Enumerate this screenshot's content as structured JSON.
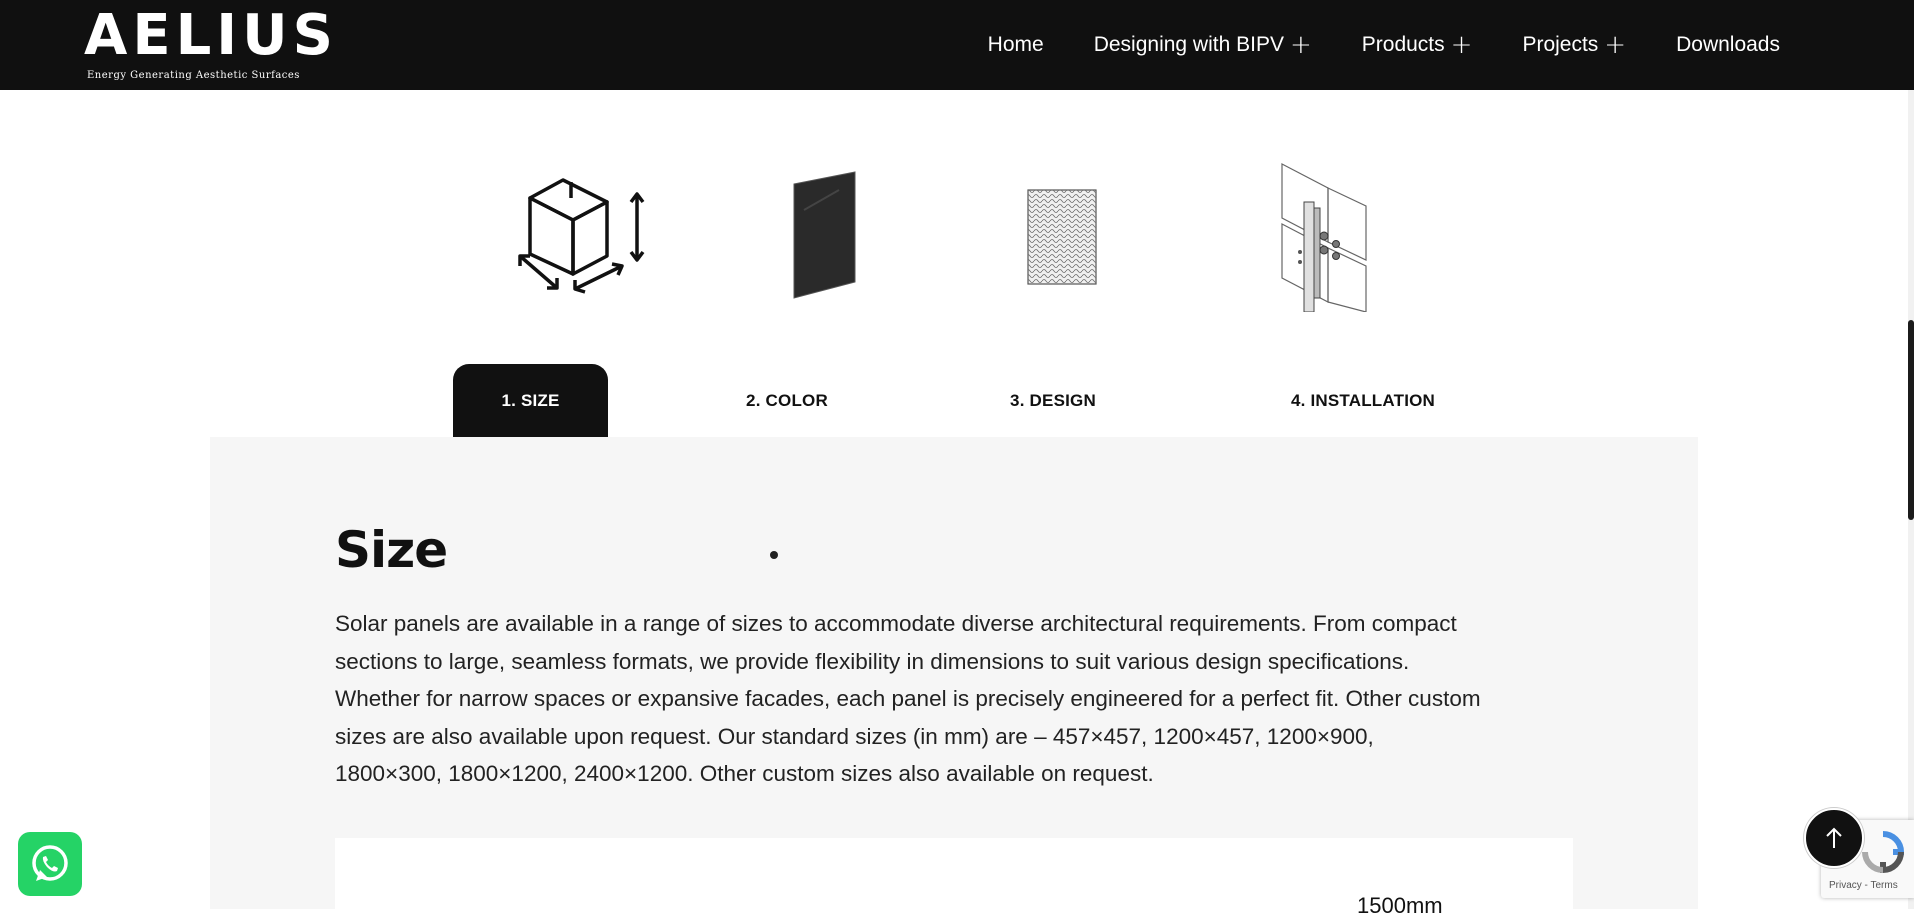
{
  "header": {
    "logo_text": "AELIUS",
    "tagline": "Energy Generating Aesthetic Surfaces",
    "nav": [
      {
        "label": "Home",
        "has_submenu": false
      },
      {
        "label": "Designing with BIPV",
        "has_submenu": true
      },
      {
        "label": "Products",
        "has_submenu": true
      },
      {
        "label": "Projects",
        "has_submenu": true
      },
      {
        "label": "Downloads",
        "has_submenu": false
      }
    ],
    "submenu_symbol": "+"
  },
  "feature_icons": [
    "size-cube-icon",
    "color-panel-icon",
    "design-texture-icon",
    "installation-bracket-icon"
  ],
  "tabs": [
    {
      "label": "1. SIZE",
      "active": true
    },
    {
      "label": "2. COLOR",
      "active": false
    },
    {
      "label": "3. DESIGN",
      "active": false
    },
    {
      "label": "4. INSTALLATION",
      "active": false
    }
  ],
  "content": {
    "title": "Size",
    "body": "Solar panels are available in a range of sizes to accommodate diverse architectural requirements. From compact sections to large, seamless formats, we provide flexibility in dimensions to suit various design specifications. Whether for narrow spaces or expansive facades, each panel is precisely engineered for a perfect fit. Other custom sizes are also available upon request. Our standard sizes (in mm) are – 457×457, 1200×457, 1200×900, 1800×300, 1800×1200, 2400×1200. Other custom sizes also available on request.",
    "dimension_label": "1500mm"
  },
  "floating": {
    "whatsapp_icon": "whatsapp-icon",
    "back_to_top_icon": "arrow-up-icon",
    "recaptcha_text": "Privacy - Terms"
  },
  "colors": {
    "header_bg": "#101010",
    "panel_bg": "#f6f6f6",
    "whatsapp": "#25d366",
    "active_tab": "#111111"
  }
}
